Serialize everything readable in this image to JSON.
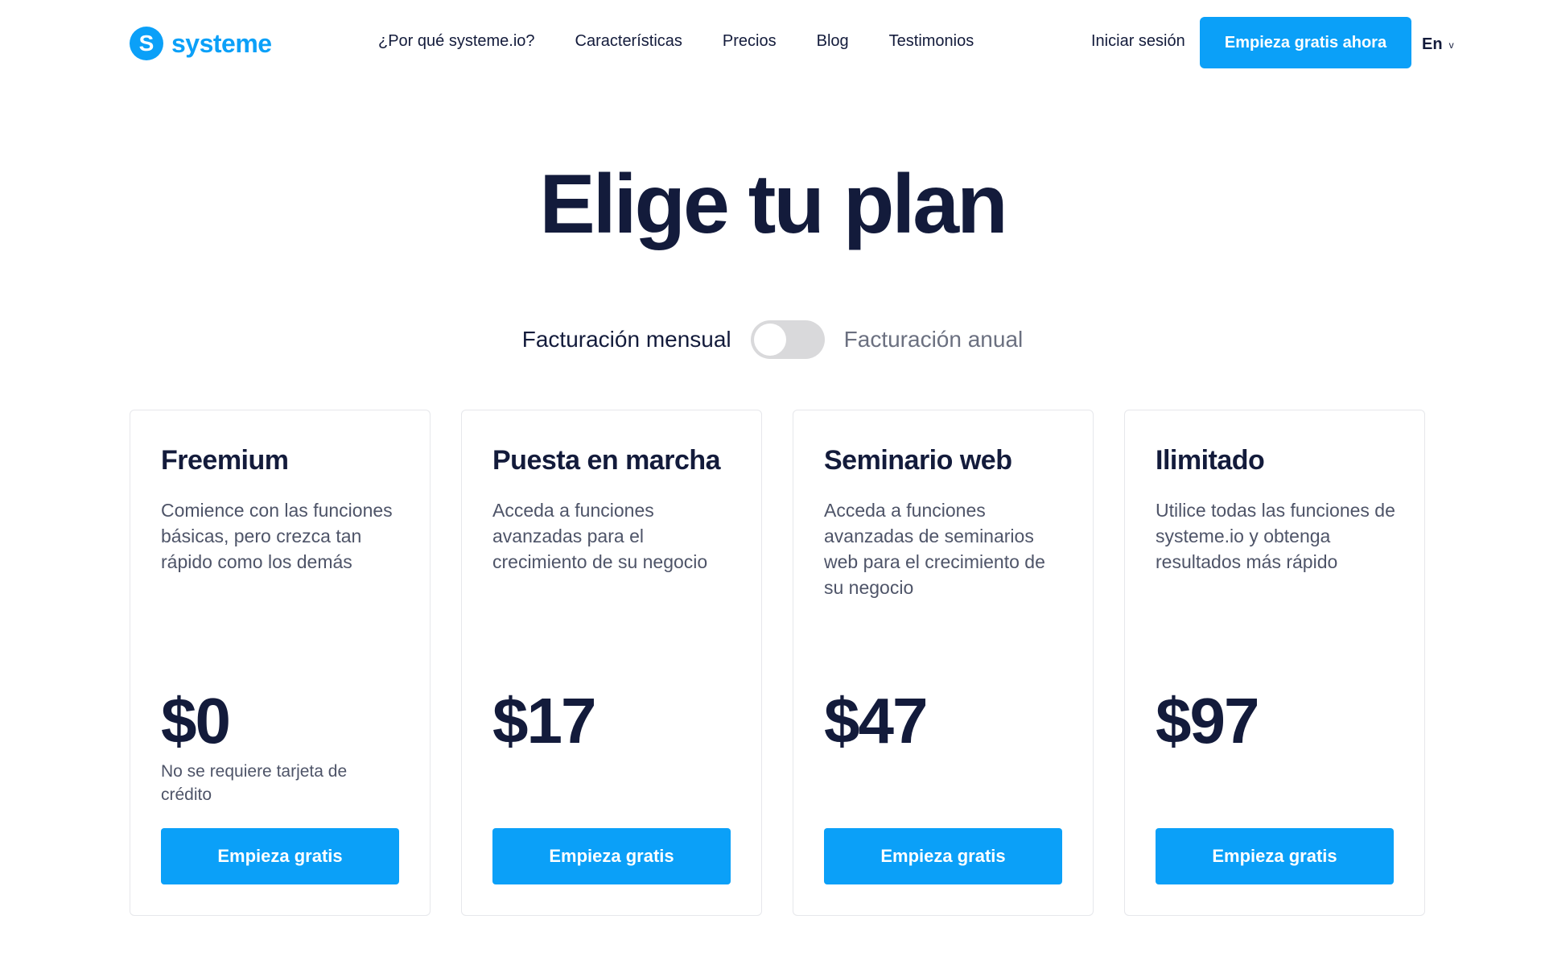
{
  "header": {
    "logo_text": "systeme",
    "logo_letter": "S",
    "nav": [
      {
        "label": "¿Por qué systeme.io?"
      },
      {
        "label": "Características"
      },
      {
        "label": "Precios"
      },
      {
        "label": "Blog"
      },
      {
        "label": "Testimonios"
      }
    ],
    "login_label": "Iniciar sesión",
    "cta_label": "Empieza gratis ahora",
    "language": "En",
    "language_chevron": "v"
  },
  "page": {
    "title": "Elige tu plan"
  },
  "billing": {
    "monthly_label": "Facturación mensual",
    "annual_label": "Facturación anual",
    "annual_selected": false
  },
  "plans": [
    {
      "name": "Freemium",
      "description": "Comience con las funciones básicas, pero crezca tan rápido como los demás",
      "price": "$0",
      "note": "No se requiere tarjeta de crédito",
      "button_label": "Empieza gratis"
    },
    {
      "name": "Puesta en marcha",
      "description": "Acceda a funciones avanzadas para el crecimiento de su negocio",
      "price": "$17",
      "note": "",
      "button_label": "Empieza gratis"
    },
    {
      "name": "Seminario web",
      "description": "Acceda a funciones avanzadas de seminarios web para el crecimiento de su negocio",
      "price": "$47",
      "note": "",
      "button_label": "Empieza gratis"
    },
    {
      "name": "Ilimitado",
      "description": "Utilice todas las funciones de systeme.io y obtenga resultados más rápido",
      "price": "$97",
      "note": "",
      "button_label": "Empieza gratis"
    }
  ],
  "colors": {
    "accent": "#0ba0f8",
    "text_dark": "#131b3b",
    "text_muted": "#4e5468",
    "card_border": "#e6e7eb",
    "toggle_bg": "#d9d9db"
  }
}
